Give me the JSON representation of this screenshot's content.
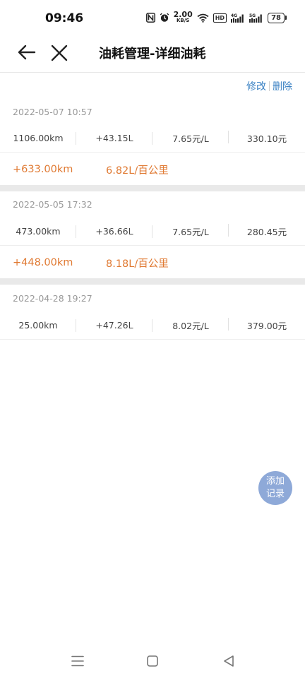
{
  "status_bar": {
    "time": "09:46",
    "speed_value": "2.00",
    "speed_unit": "KB/S",
    "hd_label": "HD",
    "net_4g": "4G",
    "net_5g": "5G",
    "battery": "78"
  },
  "header": {
    "title": "油耗管理-详细油耗"
  },
  "actions": {
    "edit_label": "修改",
    "delete_label": "删除"
  },
  "records": [
    {
      "date": "2022-05-07 10:57",
      "odometer": "1106.00km",
      "fuel": "+43.15L",
      "price": "7.65元/L",
      "cost": "330.10元",
      "distance_added": "+633.00km",
      "consumption": "6.82L/百公里"
    },
    {
      "date": "2022-05-05 17:32",
      "odometer": "473.00km",
      "fuel": "+36.66L",
      "price": "7.65元/L",
      "cost": "280.45元",
      "distance_added": "+448.00km",
      "consumption": "8.18L/百公里"
    },
    {
      "date": "2022-04-28 19:27",
      "odometer": "25.00km",
      "fuel": "+47.26L",
      "price": "8.02元/L",
      "cost": "379.00元"
    }
  ],
  "fab": {
    "line1": "添加",
    "line2": "记录"
  },
  "colors": {
    "accent": "#3b82c4",
    "highlight": "#e07a33",
    "fab_bg": "#8ea9d8"
  }
}
